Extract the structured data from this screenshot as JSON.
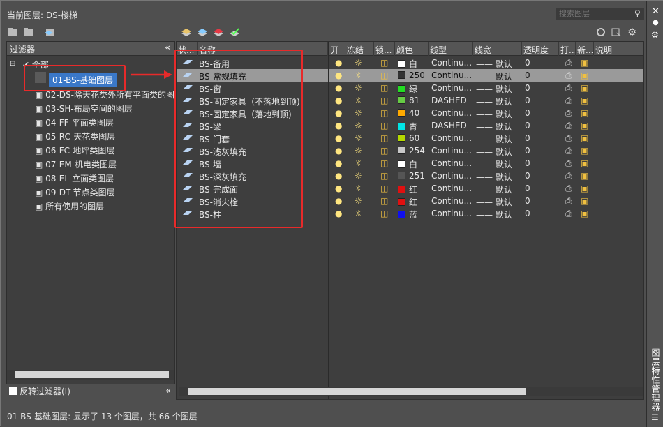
{
  "header": {
    "current_layer": "当前图层: DS-楼梯",
    "search_placeholder": "搜索图层"
  },
  "side_panel": {
    "vertical_title": "图层特性管理器"
  },
  "filters": {
    "title": "过滤器",
    "root": "全部",
    "items": [
      "01-BS-基础图层",
      "02-DS-除天花类外所有平面类的图",
      "03-SH-布局空间的图层",
      "04-FF-平面类图层",
      "05-RC-天花类图层",
      "06-FC-地坪类图层",
      "07-EM-机电类图层",
      "08-EL-立面类图层",
      "09-DT-节点类图层",
      "所有使用的图层"
    ],
    "invert_label": "反转过滤器(I)"
  },
  "columns": [
    "状...",
    "名称",
    "开",
    "冻结",
    "锁...",
    "颜色",
    "线型",
    "线宽",
    "透明度",
    "打...",
    "新...",
    "说明"
  ],
  "layers": [
    {
      "name": "BS-备用",
      "color": "#ffffff",
      "color_label": "白",
      "linetype": "Continu...",
      "lineweight": "—— 默认",
      "transparency": "0"
    },
    {
      "name": "BS-常规填充",
      "color": "#333333",
      "color_label": "250",
      "linetype": "Continu...",
      "lineweight": "—— 默认",
      "transparency": "0"
    },
    {
      "name": "BS-窗",
      "color": "#22dd22",
      "color_label": "绿",
      "linetype": "Continu...",
      "lineweight": "—— 默认",
      "transparency": "0"
    },
    {
      "name": "BS-固定家具（不落地到顶)",
      "color": "#66cc44",
      "color_label": "81",
      "linetype": "DASHED",
      "lineweight": "—— 默认",
      "transparency": "0"
    },
    {
      "name": "BS-固定家具（落地到顶)",
      "color": "#ffaa00",
      "color_label": "40",
      "linetype": "Continu...",
      "lineweight": "—— 默认",
      "transparency": "0"
    },
    {
      "name": "BS-梁",
      "color": "#00e5e5",
      "color_label": "青",
      "linetype": "DASHED",
      "lineweight": "—— 默认",
      "transparency": "0"
    },
    {
      "name": "BS-门套",
      "color": "#b5d900",
      "color_label": "60",
      "linetype": "Continu...",
      "lineweight": "—— 默认",
      "transparency": "0"
    },
    {
      "name": "BS-浅灰填充",
      "color": "#c8c8c8",
      "color_label": "254",
      "linetype": "Continu...",
      "lineweight": "—— 默认",
      "transparency": "0"
    },
    {
      "name": "BS-墙",
      "color": "#ffffff",
      "color_label": "白",
      "linetype": "Continu...",
      "lineweight": "—— 默认",
      "transparency": "0"
    },
    {
      "name": "BS-深灰填充",
      "color": "#555555",
      "color_label": "251",
      "linetype": "Continu...",
      "lineweight": "—— 默认",
      "transparency": "0"
    },
    {
      "name": "BS-完成面",
      "color": "#e01010",
      "color_label": "红",
      "linetype": "Continu...",
      "lineweight": "—— 默认",
      "transparency": "0"
    },
    {
      "name": "BS-消火栓",
      "color": "#e01010",
      "color_label": "红",
      "linetype": "Continu...",
      "lineweight": "—— 默认",
      "transparency": "0"
    },
    {
      "name": "BS-柱",
      "color": "#1010ee",
      "color_label": "蓝",
      "linetype": "Continu...",
      "lineweight": "—— 默认",
      "transparency": "0"
    }
  ],
  "status": "01-BS-基础图层: 显示了 13 个图层，共 66 个图层"
}
